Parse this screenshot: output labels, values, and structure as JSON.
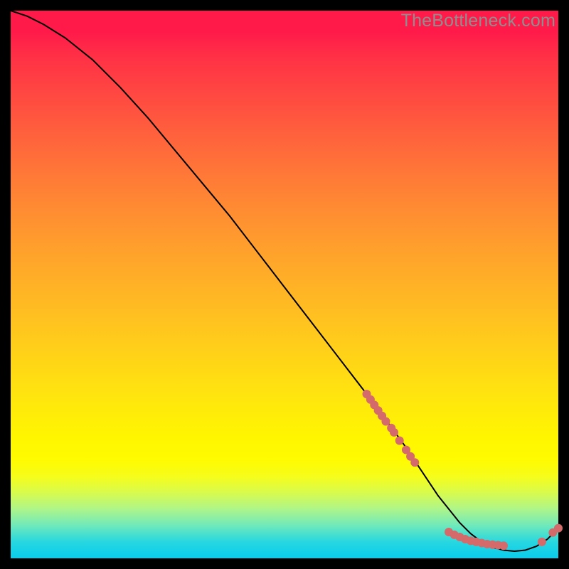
{
  "watermark": "TheBottleneck.com",
  "colors": {
    "dot": "#d46a6a",
    "curve": "#000000"
  },
  "chart_data": {
    "type": "line",
    "title": "",
    "xlabel": "",
    "ylabel": "",
    "xlim": [
      0,
      100
    ],
    "ylim": [
      0,
      100
    ],
    "grid": false,
    "legend": false,
    "series": [
      {
        "name": "curve",
        "x": [
          0,
          3,
          6,
          10,
          15,
          20,
          25,
          30,
          35,
          40,
          45,
          50,
          55,
          60,
          65,
          68,
          72,
          75,
          78,
          80,
          82,
          84,
          86,
          88,
          90,
          92,
          94,
          96,
          98,
          100
        ],
        "values": [
          100,
          99,
          97.5,
          95,
          91,
          86,
          80.5,
          74.5,
          68.5,
          62.5,
          56,
          49.5,
          43,
          36.5,
          30,
          26,
          20.5,
          16,
          11.5,
          9,
          6.5,
          4.5,
          3,
          2,
          1.5,
          1.3,
          1.5,
          2.2,
          3.5,
          5.5
        ]
      }
    ],
    "points": [
      {
        "name": "dot-cluster-upper",
        "x": 65.0,
        "y": 30.0
      },
      {
        "name": "dot-cluster-upper",
        "x": 65.7,
        "y": 29.0
      },
      {
        "name": "dot-cluster-upper",
        "x": 66.4,
        "y": 28.0
      },
      {
        "name": "dot-cluster-upper",
        "x": 67.1,
        "y": 27.0
      },
      {
        "name": "dot-cluster-upper",
        "x": 67.8,
        "y": 26.0
      },
      {
        "name": "dot-cluster-upper",
        "x": 68.5,
        "y": 25.0
      },
      {
        "name": "dot-cluster-upper",
        "x": 69.5,
        "y": 23.8
      },
      {
        "name": "dot-cluster-upper",
        "x": 70.0,
        "y": 23.0
      },
      {
        "name": "dot-cluster-upper",
        "x": 71.0,
        "y": 21.5
      },
      {
        "name": "dot-cluster-upper",
        "x": 72.2,
        "y": 19.8
      },
      {
        "name": "dot-cluster-upper",
        "x": 73.0,
        "y": 18.6
      },
      {
        "name": "dot-cluster-upper",
        "x": 73.8,
        "y": 17.5
      },
      {
        "name": "dot-cluster-lower",
        "x": 80.0,
        "y": 4.8
      },
      {
        "name": "dot-cluster-lower",
        "x": 81.0,
        "y": 4.3
      },
      {
        "name": "dot-cluster-lower",
        "x": 82.0,
        "y": 3.9
      },
      {
        "name": "dot-cluster-lower",
        "x": 83.0,
        "y": 3.5
      },
      {
        "name": "dot-cluster-lower",
        "x": 84.0,
        "y": 3.2
      },
      {
        "name": "dot-cluster-lower",
        "x": 85.0,
        "y": 3.0
      },
      {
        "name": "dot-cluster-lower",
        "x": 86.0,
        "y": 2.8
      },
      {
        "name": "dot-cluster-lower",
        "x": 87.0,
        "y": 2.6
      },
      {
        "name": "dot-cluster-lower",
        "x": 88.0,
        "y": 2.5
      },
      {
        "name": "dot-cluster-lower",
        "x": 89.0,
        "y": 2.4
      },
      {
        "name": "dot-cluster-lower",
        "x": 90.0,
        "y": 2.3
      },
      {
        "name": "dot-end",
        "x": 97.0,
        "y": 3.0
      },
      {
        "name": "dot-end",
        "x": 99.0,
        "y": 4.7
      },
      {
        "name": "dot-end",
        "x": 100.0,
        "y": 5.5
      }
    ]
  }
}
